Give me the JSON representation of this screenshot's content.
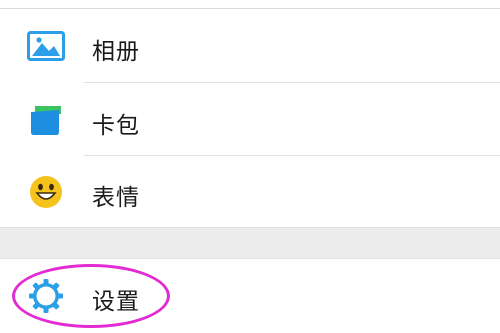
{
  "menu": {
    "items": [
      {
        "label": "相册",
        "icon": "album-icon"
      },
      {
        "label": "卡包",
        "icon": "card-wallet-icon"
      },
      {
        "label": "表情",
        "icon": "sticker-smile-icon"
      }
    ],
    "settings": {
      "label": "设置",
      "icon": "settings-gear-icon"
    }
  },
  "colors": {
    "icon_blue": "#2ba0e8",
    "card_green": "#3cc361",
    "card_blue": "#1e8fe0",
    "sticker_yellow": "#f6c21c",
    "highlight_magenta": "#e22bd3",
    "group_gap": "#ececec"
  }
}
